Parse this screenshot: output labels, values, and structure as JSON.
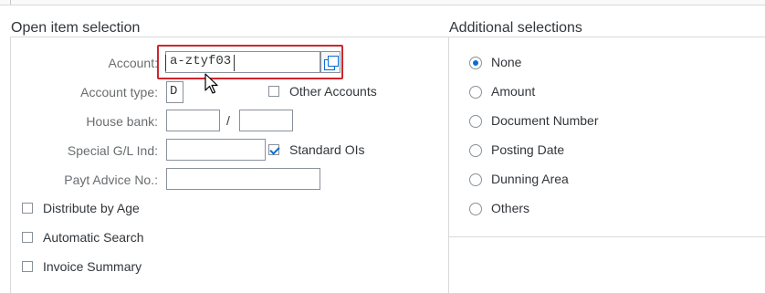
{
  "left_section": {
    "title": "Open item selection",
    "account": {
      "label": "Account:",
      "value": "a-ztyf03"
    },
    "account_type": {
      "label": "Account type:",
      "value": "D"
    },
    "other_accounts": {
      "label": "Other Accounts",
      "checked": false
    },
    "house_bank": {
      "label": "House bank:",
      "value1": "",
      "separator": "/",
      "value2": ""
    },
    "special_gl": {
      "label": "Special G/L Ind:",
      "value": ""
    },
    "standard_ois": {
      "label": "Standard OIs",
      "checked": true
    },
    "payt_advice": {
      "label": "Payt Advice No.:",
      "value": ""
    },
    "options": [
      {
        "label": "Distribute by Age",
        "checked": false
      },
      {
        "label": "Automatic Search",
        "checked": false
      },
      {
        "label": "Invoice Summary",
        "checked": false
      }
    ]
  },
  "right_section": {
    "title": "Additional selections",
    "radios": [
      {
        "label": "None",
        "selected": true
      },
      {
        "label": "Amount",
        "selected": false
      },
      {
        "label": "Document Number",
        "selected": false
      },
      {
        "label": "Posting Date",
        "selected": false
      },
      {
        "label": "Dunning Area",
        "selected": false
      },
      {
        "label": "Others",
        "selected": false
      }
    ]
  },
  "colors": {
    "accent": "#0a6ed1",
    "highlight": "#d0262d"
  }
}
